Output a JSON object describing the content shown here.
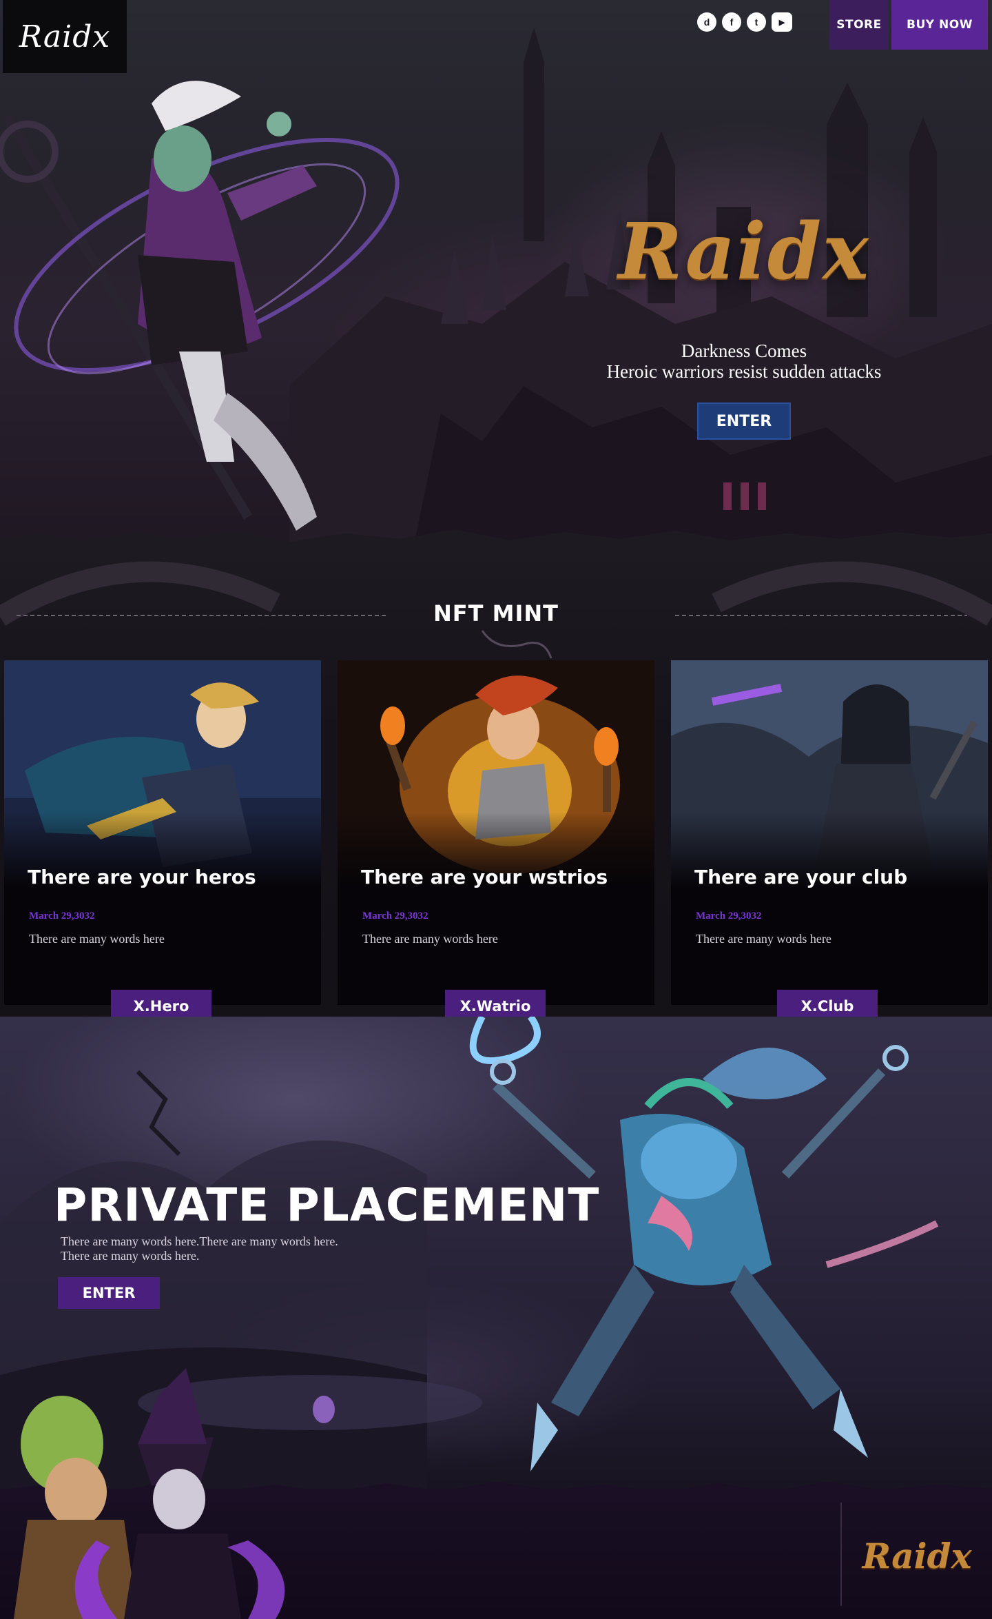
{
  "header": {
    "logo": "Raidx",
    "socials": [
      {
        "icon": "discord-icon",
        "glyph": "d"
      },
      {
        "icon": "facebook-icon",
        "glyph": "f"
      },
      {
        "icon": "twitter-icon",
        "glyph": "t"
      },
      {
        "icon": "youtube-icon",
        "glyph": "▶"
      }
    ],
    "store_label": "STORE",
    "buy_label": "BUY NOW"
  },
  "hero": {
    "title": "Raidx",
    "tagline_1": "Darkness Comes",
    "tagline_2": "Heroic warriors resist sudden attacks",
    "enter_label": "ENTER"
  },
  "mint": {
    "title": "NFT MINT",
    "cards": [
      {
        "title": "There are your heros",
        "date": "March 29,3032",
        "desc": "There are many words here",
        "button": "X.Hero"
      },
      {
        "title": "There are your wstrios",
        "date": "March 29,3032",
        "desc": "There are many words here",
        "button": "X.Watrio"
      },
      {
        "title": "There are your club",
        "date": "March 29,3032",
        "desc": "There are many words here",
        "button": "X.Club"
      }
    ]
  },
  "private": {
    "title": "PRIVATE PLACEMENT",
    "text_1": "There are many words here.There are many words here.",
    "text_2": "There are many words here.",
    "enter_label": "ENTER"
  },
  "footer": {
    "logo": "Raidx"
  },
  "colors": {
    "accent_purple": "#4a1f7e",
    "nav_purple": "#5a2596",
    "hero_enter_blue": "#1d3c78",
    "logo_gold": "#c58a3a",
    "date_purple": "#7a36d4"
  }
}
